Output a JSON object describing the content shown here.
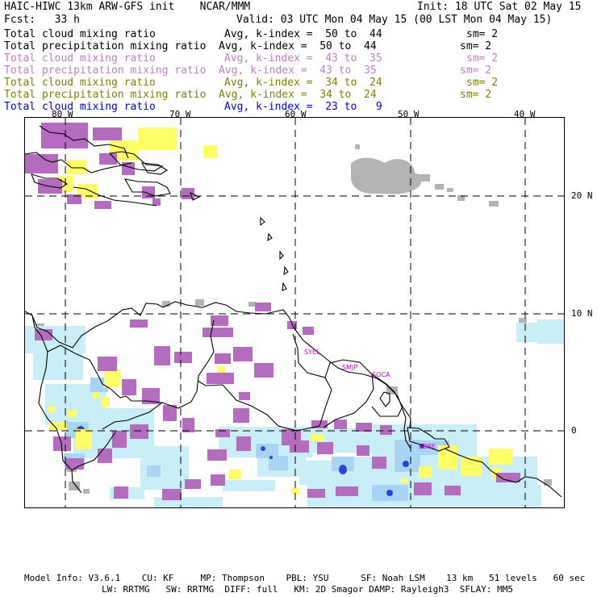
{
  "header": {
    "title_left": "HAIC-HIWC 13km ARW-GFS init    NCAR/MMM",
    "init": "Init: 18 UTC Sat 02 May 15",
    "forecast": "Fcst:   33 h",
    "valid": "Valid: 03 UTC Mon 04 May 15 (00 LST Mon 04 May 15)"
  },
  "fields": [
    {
      "name": "Total cloud mixing ratio",
      "avg": "Avg, k-index =  50 to  44",
      "sm": "sm= 2",
      "color": "#000000"
    },
    {
      "name": "Total precipitation mixing ratio",
      "avg": "Avg, k-index =  50 to  44",
      "sm": "sm= 2",
      "color": "#000000"
    },
    {
      "name": "Total cloud mixing ratio",
      "avg": "Avg, k-index =  43 to  35",
      "sm": "sm= 2",
      "color": "#c080c0"
    },
    {
      "name": "Total precipitation mixing ratio",
      "avg": "Avg, k-index =  43 to  35",
      "sm": "sm= 2",
      "color": "#c080c0"
    },
    {
      "name": "Total cloud mixing ratio",
      "avg": "Avg, k-index =  34 to  24",
      "sm": "sm= 2",
      "color": "#808000"
    },
    {
      "name": "Total precipitation mixing ratio",
      "avg": "Avg, k-index =  34 to  24",
      "sm": "sm= 2",
      "color": "#808000"
    },
    {
      "name": "Total cloud mixing ratio",
      "avg": "Avg, k-index =  23 to   9",
      "sm": "",
      "color": "#0000ff"
    }
  ],
  "map": {
    "longitude_labels": [
      "80 W",
      "70 W",
      "60 W",
      "50 W",
      "40 W"
    ],
    "latitude_labels": [
      "20 N",
      "10 N",
      "0"
    ],
    "stations": [
      "SYEL",
      "SMJP",
      "SOCA",
      "SBBE"
    ],
    "colors": {
      "grey": "#b3b3b3",
      "purple": "#b56bc0",
      "yellow": "#ffff66",
      "lightblue": "#c8eef8",
      "midblue": "#a9d5f4",
      "deepblue": "#2845d8",
      "coast": "#000000",
      "station": "#d000d0"
    }
  },
  "footer": {
    "line1": "Model Info: V3.6.1    CU: KF     MP: Thompson    PBL: YSU      SF: Noah LSM    13 km   51 levels   60 sec",
    "line2": "LW: RRTMG   SW: RRTMG  DIFF: full   KM: 2D Smagor DAMP: Rayleigh3  SFLAY: MM5"
  }
}
